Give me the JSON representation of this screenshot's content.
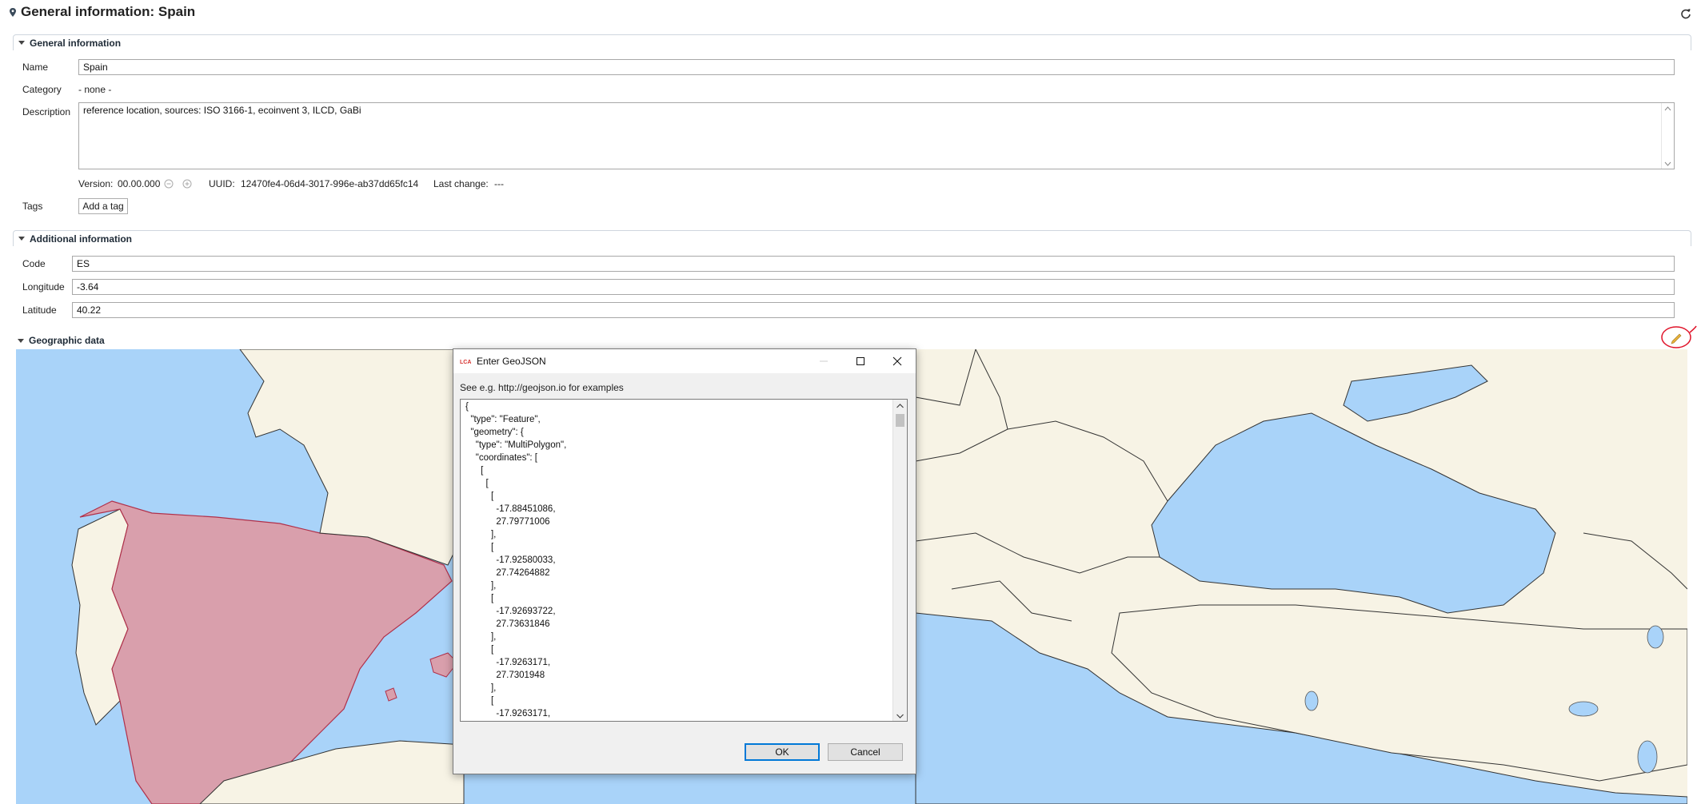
{
  "header": {
    "title": "General information: Spain",
    "icons": {
      "location": "map-pin-icon",
      "refresh": "refresh-icon"
    }
  },
  "general": {
    "section_title": "General information",
    "name_label": "Name",
    "name_value": "Spain",
    "category_label": "Category",
    "category_value": "- none -",
    "description_label": "Description",
    "description_value": "reference location, sources: ISO 3166-1, ecoinvent 3, ILCD, GaBi",
    "version_label": "Version:",
    "version_value": "00.00.000",
    "uuid_label": "UUID:",
    "uuid_value": "12470fe4-06d4-3017-996e-ab37dd65fc14",
    "last_change_label": "Last change:",
    "last_change_value": "---",
    "tags_label": "Tags",
    "add_tag_label": "Add a tag"
  },
  "additional": {
    "section_title": "Additional information",
    "code_label": "Code",
    "code_value": "ES",
    "longitude_label": "Longitude",
    "longitude_value": "-3.64",
    "latitude_label": "Latitude",
    "latitude_value": "40.22"
  },
  "geographic": {
    "section_title": "Geographic data",
    "edit_icon": "pencil-icon"
  },
  "dialog": {
    "title": "Enter GeoJSON",
    "hint": "See e.g. http://geojson.io for examples",
    "geojson_text": "{\n  \"type\": \"Feature\",\n  \"geometry\": {\n    \"type\": \"MultiPolygon\",\n    \"coordinates\": [\n      [\n        [\n          [\n            -17.88451086,\n            27.79771006\n          ],\n          [\n            -17.92580033,\n            27.74264882\n          ],\n          [\n            -17.92693722,\n            27.73631846\n          ],\n          [\n            -17.9263171,\n            27.7301948\n          ],\n          [\n            -17.9263171,",
    "ok_label": "OK",
    "cancel_label": "Cancel",
    "colors": {
      "ok_border": "#0078d7"
    }
  },
  "colors": {
    "sea": "#a9d3f9",
    "land": "#f7f3e5",
    "highlight": "#d99fac",
    "highlight_border": "#b0304a"
  }
}
